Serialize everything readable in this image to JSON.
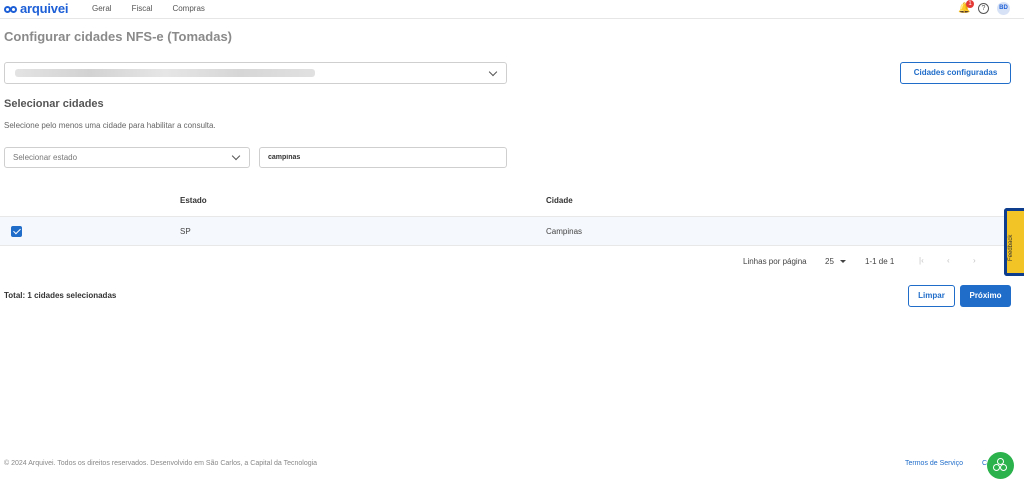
{
  "header": {
    "logo_text": "arquivei",
    "nav": [
      "Geral",
      "Fiscal",
      "Compras"
    ],
    "notification_count": "1",
    "help_symbol": "?",
    "avatar_initials": "BD"
  },
  "page": {
    "title": "Configurar cidades NFS-e (Tomadas)",
    "cities_configured_button": "Cidades configuradas"
  },
  "selection": {
    "title": "Selecionar cidades",
    "description": "Selecione pelo menos uma cidade para habilitar a consulta.",
    "state_placeholder": "Selecionar estado",
    "city_search_value": "campinas"
  },
  "table": {
    "headers": {
      "state": "Estado",
      "city": "Cidade"
    },
    "rows": [
      {
        "checked": true,
        "state": "SP",
        "city": "Campinas"
      }
    ]
  },
  "pagination": {
    "rows_per_page_label": "Linhas por página",
    "rows_per_page": "25",
    "range": "1-1 de 1"
  },
  "summary": {
    "total": "Total: 1 cidades selecionadas",
    "clear_button": "Limpar",
    "next_button": "Próximo"
  },
  "feedback_tab": "Feedback",
  "footer": {
    "copyright": "© 2024 Arquivei. Todos os direitos reservados. Desenvolvido em São Carlos, a Capital da Tecnologia",
    "terms": "Termos de Serviço",
    "partial_link": "C"
  },
  "colors": {
    "primary": "#1f6cc9",
    "brand": "#1d5fd6",
    "feedback_bg": "#f2c425",
    "chat_fab": "#2bb24c"
  }
}
